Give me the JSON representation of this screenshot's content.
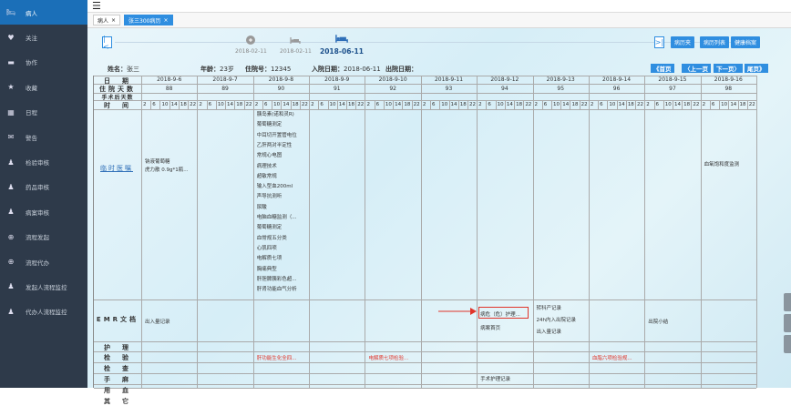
{
  "sidebar": {
    "items": [
      {
        "label": "病人",
        "icon": "bed-icon"
      },
      {
        "label": "关注",
        "icon": "heart-icon"
      },
      {
        "label": "协作",
        "icon": "chat-icon"
      },
      {
        "label": "收藏",
        "icon": "star-icon"
      },
      {
        "label": "日程",
        "icon": "calendar-icon"
      },
      {
        "label": "警告",
        "icon": "alert-icon"
      },
      {
        "label": "检验审核",
        "icon": "user-icon"
      },
      {
        "label": "药品审核",
        "icon": "user-icon"
      },
      {
        "label": "病案审核",
        "icon": "user-icon"
      },
      {
        "label": "流程发起",
        "icon": "plus-circle-icon"
      },
      {
        "label": "流程代办",
        "icon": "plus-circle-icon"
      },
      {
        "label": "发起人流程监控",
        "icon": "user-icon"
      },
      {
        "label": "代办人流程监控",
        "icon": "user-icon"
      }
    ]
  },
  "tabs": [
    {
      "label": "病人",
      "close": "×"
    },
    {
      "label": "张三300病历",
      "close": "×"
    }
  ],
  "timeline": {
    "nodes": [
      {
        "date": "2018-02-11"
      },
      {
        "date": "2018-02-11"
      },
      {
        "date": "2018-06-11"
      }
    ],
    "first_glyph": "|<",
    "last_glyph": ">|",
    "buttons": [
      "病历夹",
      "病历列表",
      "健康档案"
    ]
  },
  "patient": {
    "name_label": "姓名：",
    "name": "张三",
    "age_label": "年龄：",
    "age": "23岁",
    "bed_label": "住院号：",
    "bed": "12345",
    "admit_label": "入院日期：",
    "admit": "2018-06-11",
    "discharge_label": "出院日期：",
    "discharge": ""
  },
  "pager": [
    "《首页",
    "〈上一页",
    "下一页〉",
    "尾页》"
  ],
  "row_labels": {
    "date": "日　期",
    "hosp_days": "住院天数",
    "op_days": "手术后天数",
    "time": "时　间",
    "clinical": "临时医嘱",
    "emr": "EMR文档",
    "nursing": "护　理",
    "lab": "检　验",
    "exam": "检　查",
    "surgery": "手　麻",
    "blood": "用　血",
    "other": "其　它"
  },
  "days": [
    {
      "date": "2018-9-6",
      "hosp": "88"
    },
    {
      "date": "2018-9-7",
      "hosp": "89"
    },
    {
      "date": "2018-9-8",
      "hosp": "90"
    },
    {
      "date": "2018-9-9",
      "hosp": "91"
    },
    {
      "date": "2018-9-10",
      "hosp": "92"
    },
    {
      "date": "2018-9-11",
      "hosp": "93"
    },
    {
      "date": "2018-9-12",
      "hosp": "94"
    },
    {
      "date": "2018-9-13",
      "hosp": "95"
    },
    {
      "date": "2018-9-14",
      "hosp": "96"
    },
    {
      "date": "2018-9-15",
      "hosp": "97"
    },
    {
      "date": "2018-9-16",
      "hosp": "98"
    }
  ],
  "hours": [
    "2",
    "6",
    "10",
    "14",
    "18",
    "22"
  ],
  "clinical_orders": {
    "day0": [
      "钠液葡萄糖",
      "虎力散 0.9g*1瓶..."
    ],
    "day2": [
      "胰岛素(诺和灵R)",
      "葡萄糖测定",
      "中耳切开置管电位",
      "乙肝两对半定性",
      "常规心电图",
      "病理技术",
      "超敏常规",
      "输入型血200ml",
      "声导抗测听",
      "尿酸",
      "电脑血糖监测（...",
      "葡萄糖测定",
      "血常规五分类",
      "心肌四项",
      "电解质七项",
      "胸痛典型",
      "肝胆脾胰彩色超...",
      "肝肾功能血气分析"
    ],
    "day10": [
      "血氧饱和度监测"
    ]
  },
  "emr": {
    "day0": [
      "出入量记录"
    ],
    "day6": [
      "病危（危）护理...",
      "病案首页"
    ],
    "day7": [
      "转科产记录",
      "24h内入出院记录",
      "出入量记录"
    ],
    "day9": [
      "出院小结"
    ]
  },
  "lab": {
    "day2": "肝功能生化全四...",
    "day4": "电解质七项检验...",
    "day8": "血脂六项检验规..."
  },
  "surgery": {
    "day6": "手术护理记录"
  }
}
